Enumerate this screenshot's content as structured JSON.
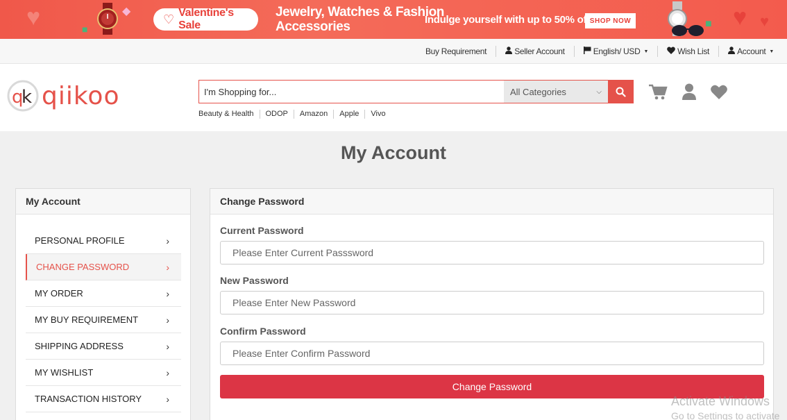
{
  "banner": {
    "sale_label": "Valentine's Sale",
    "headline_line1": "Jewelry, Watches & Fashion",
    "headline_line2": "Accessories",
    "offer_text": "Indulge yourself with up to 50% off",
    "cta_label": "SHOP NOW"
  },
  "topbar": {
    "buy_requirement": "Buy Requirement",
    "seller_account": "Seller Account",
    "language_currency": "English/ USD",
    "wish_list": "Wish List",
    "account": "Account"
  },
  "header": {
    "logo_mark": "qk",
    "logo_text": "qiikoo",
    "search_placeholder": "I'm Shopping for...",
    "category_selected": "All Categories",
    "quick_links": [
      "Beauty & Health",
      "ODOP",
      "Amazon",
      "Apple",
      "Vivo"
    ]
  },
  "page": {
    "title": "My Account"
  },
  "sidebar": {
    "heading": "My Account",
    "items": [
      {
        "label": "PERSONAL PROFILE",
        "active": false
      },
      {
        "label": "CHANGE PASSWORD",
        "active": true
      },
      {
        "label": "MY ORDER",
        "active": false
      },
      {
        "label": "MY BUY REQUIREMENT",
        "active": false
      },
      {
        "label": "SHIPPING ADDRESS",
        "active": false
      },
      {
        "label": "MY WISHLIST",
        "active": false
      },
      {
        "label": "TRANSACTION HISTORY",
        "active": false
      }
    ]
  },
  "form": {
    "heading": "Change Password",
    "current_label": "Current Password",
    "current_placeholder": "Please Enter Current Passsword",
    "new_label": "New Password",
    "new_placeholder": "Please Enter New Password",
    "confirm_label": "Confirm Password",
    "confirm_placeholder": "Please Enter Confirm Password",
    "submit_label": "Change Password"
  },
  "watermark": {
    "line1": "Activate Windows",
    "line2": "Go to Settings to activate"
  },
  "colors": {
    "accent": "#e5524a",
    "button": "#dc3545",
    "banner": "#f35b4d"
  },
  "icons": {
    "cart": "cart-icon",
    "user": "user-icon",
    "wishlist": "heart-icon",
    "search": "search-icon"
  }
}
